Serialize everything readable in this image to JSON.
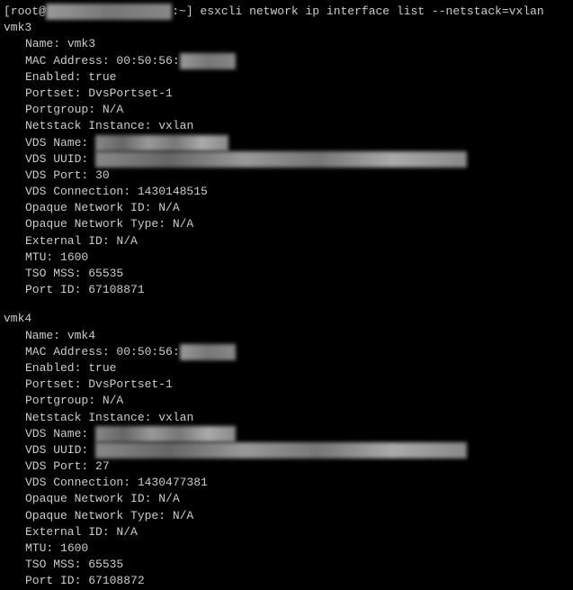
{
  "prompt": {
    "user_host": "[root@",
    "host_redacted": "██████████████████",
    "path_sep": ":~] ",
    "command": "esxcli network ip interface list --netstack=vxlan"
  },
  "interfaces": [
    {
      "id": "vmk3",
      "name": "vmk3",
      "mac_prefix": "00:50:56:",
      "mac_redacted": "██:██:██",
      "enabled": "true",
      "portset": "DvsPortset-1",
      "portgroup": "N/A",
      "netstack": "vxlan",
      "vds_name_redacted": "███-████-██████-███",
      "vds_uuid_redacted": "██ ██ ██ ██ ██ ██ ██ ██ ██-██ ██ ██ ██ ██ ██ ██ ██ ██",
      "vds_port": "30",
      "vds_connection": "1430148515",
      "opaque_network_id": "N/A",
      "opaque_network_type": "N/A",
      "external_id": "N/A",
      "mtu": "1600",
      "tso_mss": "65535",
      "port_id": "67108871"
    },
    {
      "id": "vmk4",
      "name": "vmk4",
      "mac_prefix": "00:50:56:",
      "mac_redacted": "██:██:██",
      "enabled": "true",
      "portset": "DvsPortset-1",
      "portgroup": "N/A",
      "netstack": "vxlan",
      "vds_name_redacted": "███-████-██.███-████",
      "vds_uuid_redacted": "██ ██ ██ ██ ██ ██ ██ ██ ██-██ ██ ██ ██ ██ ██ ██ ██ ██",
      "vds_port": "27",
      "vds_connection": "1430477381",
      "opaque_network_id": "N/A",
      "opaque_network_type": "N/A",
      "external_id": "N/A",
      "mtu": "1600",
      "tso_mss": "65535",
      "port_id": "67108872"
    }
  ],
  "labels": {
    "name": "Name: ",
    "mac_address": "MAC Address: ",
    "enabled": "Enabled: ",
    "portset": "Portset: ",
    "portgroup": "Portgroup: ",
    "netstack": "Netstack Instance: ",
    "vds_name": "VDS Name: ",
    "vds_uuid": "VDS UUID: ",
    "vds_port": "VDS Port: ",
    "vds_connection": "VDS Connection: ",
    "opaque_network_id": "Opaque Network ID: ",
    "opaque_network_type": "Opaque Network Type: ",
    "external_id": "External ID: ",
    "mtu": "MTU: ",
    "tso_mss": "TSO MSS: ",
    "port_id": "Port ID: "
  }
}
